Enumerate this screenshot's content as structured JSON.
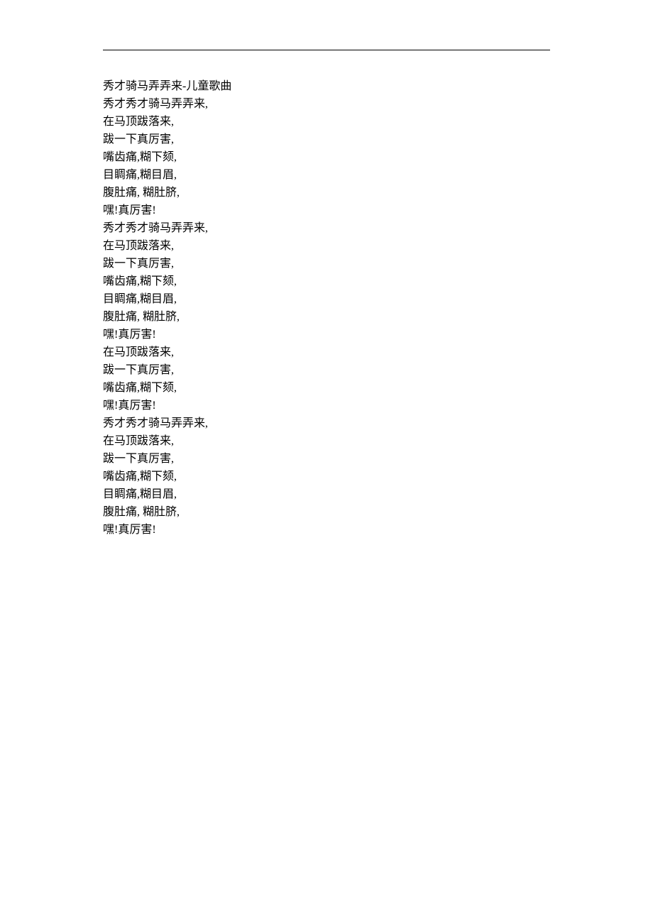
{
  "title": "秀才骑马弄弄来-儿童歌曲",
  "lines": [
    "秀才骑马弄弄来-儿童歌曲",
    "秀才秀才骑马弄弄来,",
    "在马顶跋落来,",
    "跋一下真厉害,",
    "嘴齿痛,糊下颏,",
    "目睭痛,糊目眉,",
    "腹肚痛, 糊肚脐,",
    "嘿!真厉害!",
    "秀才秀才骑马弄弄来,",
    "在马顶跋落来,",
    "跋一下真厉害,",
    "嘴齿痛,糊下颏,",
    "目睭痛,糊目眉,",
    "腹肚痛, 糊肚脐,",
    "嘿!真厉害!",
    "在马顶跋落来,",
    "跋一下真厉害,",
    "嘴齿痛,糊下颏,",
    "嘿!真厉害!",
    "秀才秀才骑马弄弄来,",
    "在马顶跋落来,",
    "跋一下真厉害,",
    "嘴齿痛,糊下颏,",
    "目睭痛,糊目眉,",
    "腹肚痛, 糊肚脐,",
    "嘿!真厉害!"
  ]
}
